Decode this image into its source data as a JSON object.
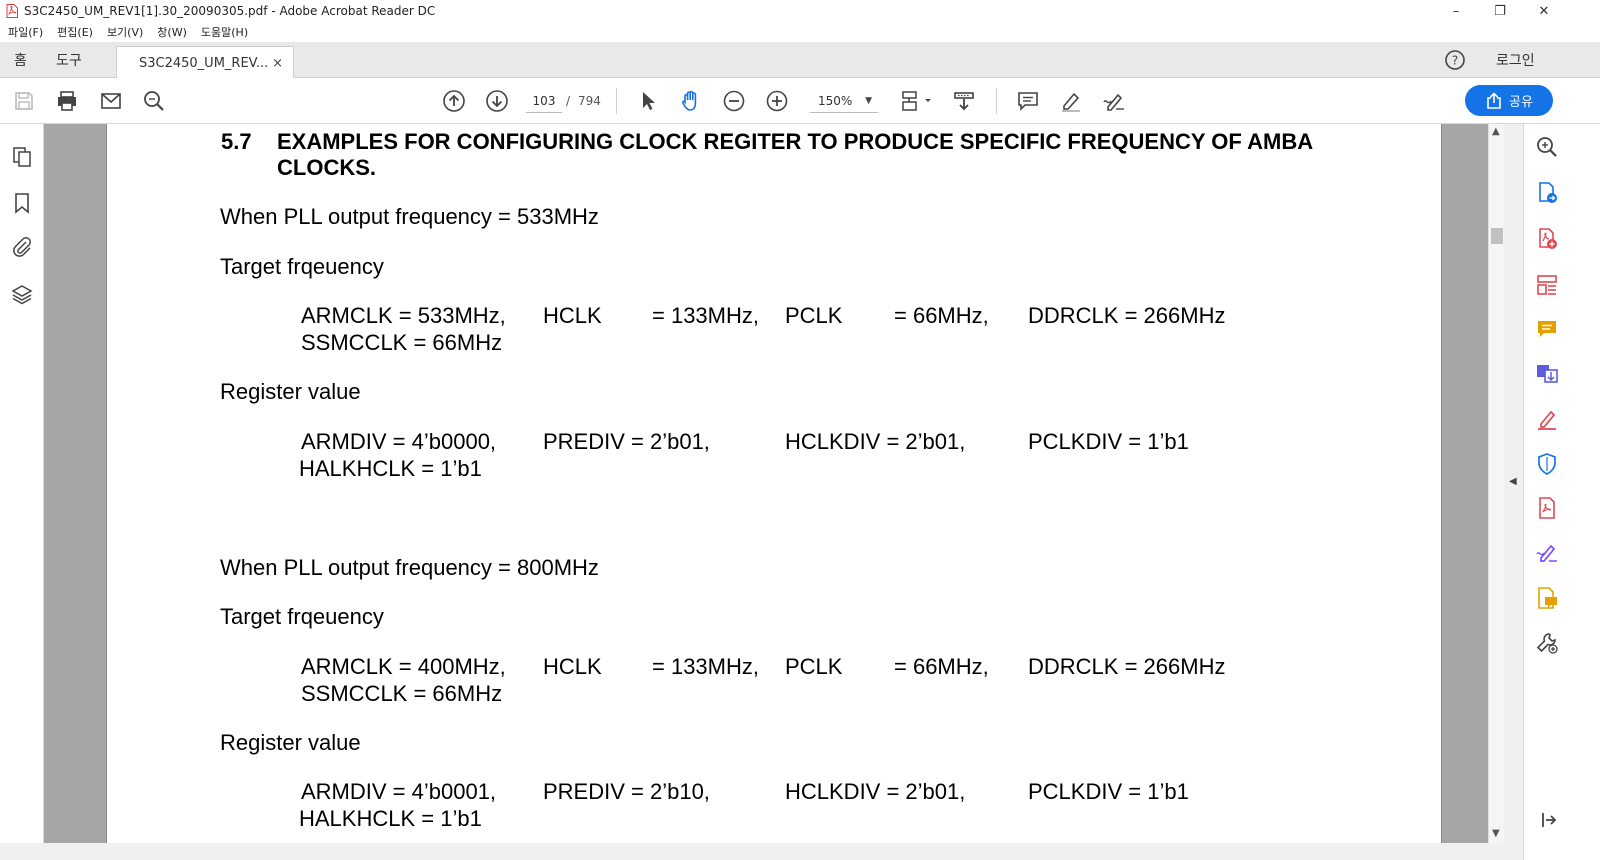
{
  "window": {
    "title": "S3C2450_UM_REV1[1].30_20090305.pdf - Adobe Acrobat Reader DC",
    "controls": {
      "minimize": "–",
      "maximize": "❐",
      "close": "✕"
    }
  },
  "menu": [
    "파일(F)",
    "편집(E)",
    "보기(V)",
    "창(W)",
    "도움말(H)"
  ],
  "tabs": {
    "home": "홈",
    "tools": "도구",
    "document": "S3C2450_UM_REV...",
    "close": "×",
    "login": "로그인"
  },
  "toolbar": {
    "page_current": "103",
    "page_separator": "/",
    "page_total": "794",
    "zoom": "150%",
    "share_label": "공유"
  },
  "document": {
    "heading_number": "5.7",
    "heading_line1": "EXAMPLES FOR CONFIGURING CLOCK REGITER TO PRODUCE SPECIFIC FREQUENCY OF AMBA",
    "heading_line2": "CLOCKS.",
    "sections": [
      {
        "pll_line": "When PLL output frequency = 533MHz",
        "target_label": "Target frqeuency",
        "targets": {
          "armclk": "ARMCLK   = 533MHz,",
          "hclk_name": "HCLK",
          "hclk_val": "= 133MHz,",
          "pclk_name": "PCLK",
          "pclk_val": "= 66MHz,",
          "ddrclk": "DDRCLK   = 266MHz",
          "ssmcclk": "SSMCCLK = 66MHz"
        },
        "register_label": "Register value",
        "registers": {
          "armdiv": "ARMDIV = 4’b0000,",
          "prediv": "PREDIV  = 2’b01,",
          "hclkdiv": "HCLKDIV = 2’b01,",
          "pclkdiv": "PCLKDIV = 1’b1",
          "halkhclk": "HALKHCLK = 1’b1"
        }
      },
      {
        "pll_line": "When PLL output frequency = 800MHz",
        "target_label": "Target frqeuency",
        "targets": {
          "armclk": "ARMCLK   = 400MHz,",
          "hclk_name": "HCLK",
          "hclk_val": "= 133MHz,",
          "pclk_name": "PCLK",
          "pclk_val": "= 66MHz,",
          "ddrclk": "DDRCLK   = 266MHz",
          "ssmcclk": "SSMCCLK = 66MHz"
        },
        "register_label": "Register value",
        "registers": {
          "armdiv": "ARMDIV = 4’b0001,",
          "prediv": "PREDIV = 2’b10,",
          "hclkdiv": "HCLKDIV = 2’b01,",
          "pclkdiv": "PCLKDIV = 1’b1",
          "halkhclk": "HALKHCLK = 1’b1"
        }
      }
    ]
  },
  "colors": {
    "accent": "#1473e6",
    "page_bg": "#ffffff",
    "doc_bg": "#a6a6a6",
    "right_tools": [
      "#1473e6",
      "#e34850",
      "#e34850",
      "#e3a100",
      "#5c5ce0",
      "#e34850",
      "#1473e6",
      "#e34850",
      "#7c4dff",
      "#e3a100",
      "#444444"
    ]
  }
}
